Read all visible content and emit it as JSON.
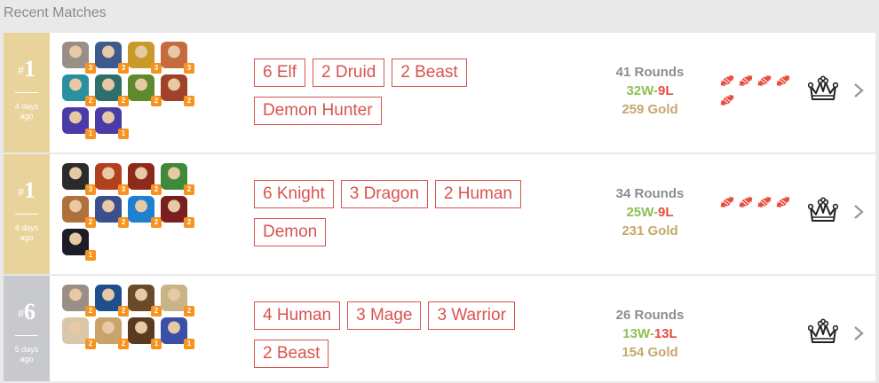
{
  "header": {
    "title": "Recent Matches"
  },
  "colors": {
    "rank_gold": "#e8d39a",
    "rank_grey": "#c7c9cc",
    "tag_red": "#d9534f",
    "wins_green": "#8cc152",
    "losses_red": "#e74c3c",
    "gold_text": "#c5a86b",
    "level_orange": "#f7931e"
  },
  "matches": [
    {
      "place_hash": "#",
      "place": "1",
      "ago": "4 days ago",
      "rank_style": "gold",
      "heroes": [
        {
          "icon": "hero-portrait-icon",
          "color": "#9a8f86",
          "level": "3"
        },
        {
          "icon": "hero-portrait-icon",
          "color": "#3c5b8c",
          "level": "3"
        },
        {
          "icon": "hero-portrait-icon",
          "color": "#c79a2a",
          "level": "3"
        },
        {
          "icon": "hero-portrait-icon",
          "color": "#c66b3d",
          "level": "3"
        },
        {
          "icon": "hero-portrait-icon",
          "color": "#2a8fa0",
          "level": "2"
        },
        {
          "icon": "hero-portrait-icon",
          "color": "#2f6f6b",
          "level": "2"
        },
        {
          "icon": "hero-portrait-icon",
          "color": "#5f8a2c",
          "level": "2"
        },
        {
          "icon": "hero-portrait-icon",
          "color": "#a0412a",
          "level": "2"
        },
        {
          "icon": "hero-portrait-icon",
          "color": "#4a3ca8",
          "level": "1"
        },
        {
          "icon": "hero-portrait-icon",
          "color": "#4a3ca8",
          "level": "1"
        }
      ],
      "tags": [
        "6 Elf",
        "2 Druid",
        "2 Beast",
        "Demon Hunter"
      ],
      "rounds": "41 Rounds",
      "wins": "32W",
      "dash": "-",
      "losses": "9L",
      "gold": "259 Gold",
      "candy_count": 5
    },
    {
      "place_hash": "#",
      "place": "1",
      "ago": "4 days ago",
      "rank_style": "gold",
      "heroes": [
        {
          "icon": "hero-portrait-icon",
          "color": "#2b2b2b",
          "level": "3"
        },
        {
          "icon": "hero-portrait-icon",
          "color": "#b2401f",
          "level": "3"
        },
        {
          "icon": "hero-portrait-icon",
          "color": "#8e2a1c",
          "level": "2"
        },
        {
          "icon": "hero-portrait-icon",
          "color": "#3f8a3a",
          "level": "2"
        },
        {
          "icon": "hero-portrait-icon",
          "color": "#b0703a",
          "level": "2"
        },
        {
          "icon": "hero-portrait-icon",
          "color": "#3a4f8c",
          "level": "2"
        },
        {
          "icon": "hero-portrait-icon",
          "color": "#1f7fd0",
          "level": "2"
        },
        {
          "icon": "hero-portrait-icon",
          "color": "#7a1f1f",
          "level": "2"
        },
        {
          "icon": "hero-portrait-icon",
          "color": "#1d1d2a",
          "level": "1"
        }
      ],
      "tags": [
        "6 Knight",
        "3 Dragon",
        "2 Human",
        "Demon"
      ],
      "rounds": "34 Rounds",
      "wins": "25W",
      "dash": "-",
      "losses": "9L",
      "gold": "231 Gold",
      "candy_count": 4
    },
    {
      "place_hash": "#",
      "place": "6",
      "ago": "5 days ago",
      "rank_style": "grey",
      "heroes": [
        {
          "icon": "hero-portrait-icon",
          "color": "#9a8f86",
          "level": "2"
        },
        {
          "icon": "hero-portrait-icon",
          "color": "#1e4f8c",
          "level": "2"
        },
        {
          "icon": "hero-portrait-icon",
          "color": "#6b4a2a",
          "level": "2"
        },
        {
          "icon": "hero-portrait-icon",
          "color": "#c9b48a",
          "level": "2"
        },
        {
          "icon": "hero-portrait-icon",
          "color": "#d8c7a8",
          "level": "2"
        },
        {
          "icon": "hero-portrait-icon",
          "color": "#c9a46a",
          "level": "2"
        },
        {
          "icon": "hero-portrait-icon",
          "color": "#5b3a22",
          "level": "1"
        },
        {
          "icon": "hero-portrait-icon",
          "color": "#3a4fa8",
          "level": "1"
        }
      ],
      "tags": [
        "4 Human",
        "3 Mage",
        "3 Warrior",
        "2 Beast"
      ],
      "rounds": "26 Rounds",
      "wins": "13W",
      "dash": "-",
      "losses": "13L",
      "gold": "154 Gold",
      "candy_count": 0
    }
  ]
}
